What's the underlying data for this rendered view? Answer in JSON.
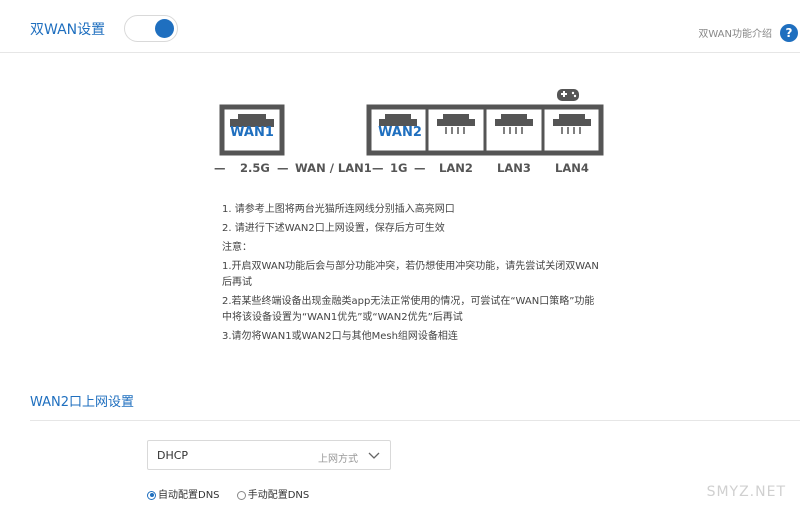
{
  "header": {
    "title": "双WAN设置",
    "toggle_on": true,
    "help_link": "双WAN功能介绍",
    "help_icon_label": "?"
  },
  "diagram": {
    "port_labels": [
      "WAN1",
      "WAN2"
    ],
    "legend": {
      "dash_1": "—",
      "speed_1": "2.5G",
      "dash_2": "—",
      "wan_lan1": "WAN / LAN1",
      "dash_3": "—",
      "speed_2": "1G",
      "dash_4": "—",
      "lan2": "LAN2",
      "lan3": "LAN3",
      "lan4": "LAN4"
    },
    "game_icon": "gamepad-icon"
  },
  "instructions": {
    "step1": "1. 请参考上图将两台光猫所连网线分别插入高亮网口",
    "step2": "2. 请进行下述WAN2口上网设置，保存后方可生效",
    "note_title": "注意：",
    "note1": "1.开启双WAN功能后会与部分功能冲突，若仍想使用冲突功能，请先尝试关闭双WAN后再试",
    "note2": "2.若某些终端设备出现金融类app无法正常使用的情况，可尝试在“WAN口策略”功能中将该设备设置为“WAN1优先”或“WAN2优先”后再试",
    "note3": "3.请勿将WAN1或WAN2口与其他Mesh组网设备相连"
  },
  "wan2": {
    "section_title": "WAN2口上网设置",
    "select_value": "DHCP",
    "select_label": "上网方式",
    "dns_auto": "自动配置DNS",
    "dns_manual": "手动配置DNS",
    "dns_selected": "auto"
  },
  "watermark": "SMYZ.NET",
  "colors": {
    "accent": "#1f6fbf",
    "port_outline": "#555555"
  }
}
